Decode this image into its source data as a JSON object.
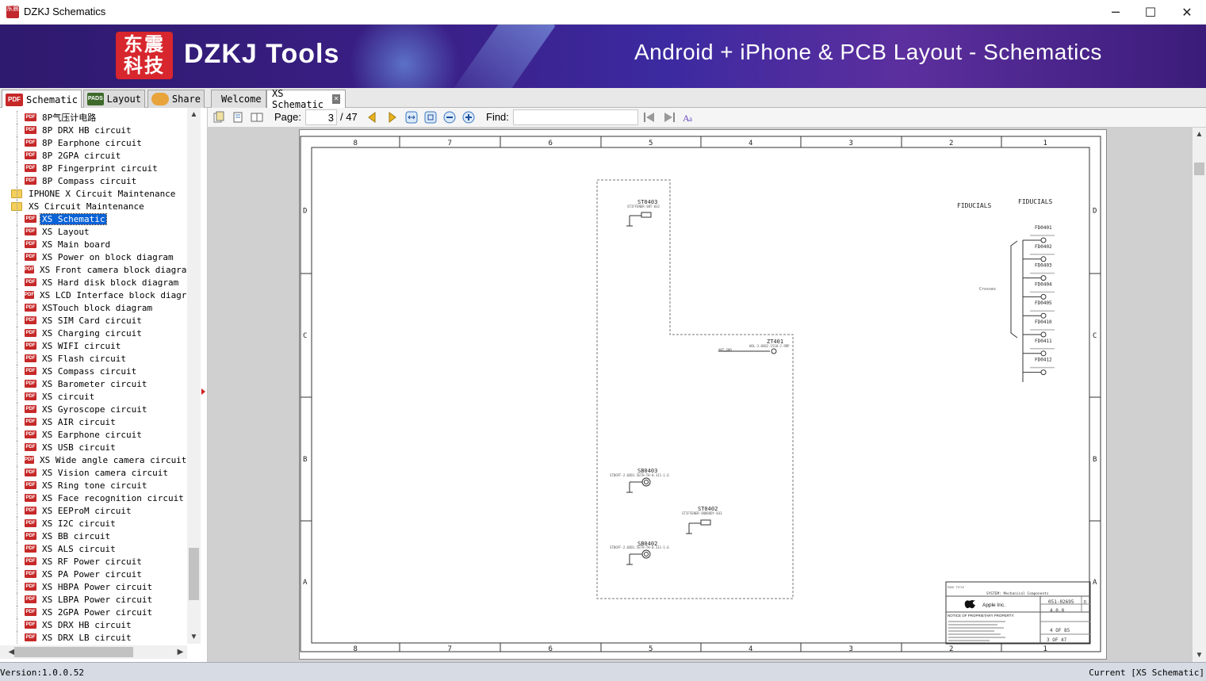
{
  "window": {
    "title": "DZKJ Schematics",
    "icon_label": "东震",
    "minimize": "─",
    "maximize": "☐",
    "close": "✕"
  },
  "banner": {
    "logo_line1": "东震",
    "logo_line2": "科技",
    "brand": "DZKJ Tools",
    "tagline": "Android + iPhone & PCB Layout - Schematics"
  },
  "left_tabs": [
    {
      "icon": "PDF",
      "label": "Schematic"
    },
    {
      "icon": "PADS",
      "label": "Layout"
    },
    {
      "icon": "",
      "label": "Share"
    }
  ],
  "doc_tabs": [
    {
      "label": "Welcome"
    },
    {
      "label": "XS Schematic"
    }
  ],
  "tree": {
    "items": [
      {
        "type": "pdf",
        "label": "8P气压计电路",
        "level": 2
      },
      {
        "type": "pdf",
        "label": "8P DRX HB circuit",
        "level": 2
      },
      {
        "type": "pdf",
        "label": "8P Earphone circuit",
        "level": 2
      },
      {
        "type": "pdf",
        "label": "8P 2GPA circuit",
        "level": 2
      },
      {
        "type": "pdf",
        "label": "8P Fingerprint circuit",
        "level": 2
      },
      {
        "type": "pdf",
        "label": "8P Compass circuit",
        "level": 2
      },
      {
        "type": "folder",
        "label": "IPHONE X Circuit Maintenance",
        "level": 1
      },
      {
        "type": "folder",
        "label": "XS Circuit Maintenance",
        "level": 1
      },
      {
        "type": "pdf",
        "label": "XS Schematic",
        "level": 2,
        "selected": true
      },
      {
        "type": "pdf",
        "label": "XS Layout",
        "level": 2
      },
      {
        "type": "pdf",
        "label": "XS Main board",
        "level": 2
      },
      {
        "type": "pdf",
        "label": "XS Power on block diagram",
        "level": 2
      },
      {
        "type": "pdf",
        "label": "XS Front camera block diagram",
        "level": 2
      },
      {
        "type": "pdf",
        "label": "XS Hard disk block diagram",
        "level": 2
      },
      {
        "type": "pdf",
        "label": "XS LCD Interface block diagram",
        "level": 2
      },
      {
        "type": "pdf",
        "label": "XSTouch block diagram",
        "level": 2
      },
      {
        "type": "pdf",
        "label": "XS SIM Card circuit",
        "level": 2
      },
      {
        "type": "pdf",
        "label": "XS Charging circuit",
        "level": 2
      },
      {
        "type": "pdf",
        "label": "XS WIFI circuit",
        "level": 2
      },
      {
        "type": "pdf",
        "label": "XS Flash circuit",
        "level": 2
      },
      {
        "type": "pdf",
        "label": "XS Compass circuit",
        "level": 2
      },
      {
        "type": "pdf",
        "label": "XS Barometer circuit",
        "level": 2
      },
      {
        "type": "pdf",
        "label": "XS circuit",
        "level": 2
      },
      {
        "type": "pdf",
        "label": "XS Gyroscope circuit",
        "level": 2
      },
      {
        "type": "pdf",
        "label": "XS AIR circuit",
        "level": 2
      },
      {
        "type": "pdf",
        "label": "XS Earphone circuit",
        "level": 2
      },
      {
        "type": "pdf",
        "label": "XS USB circuit",
        "level": 2
      },
      {
        "type": "pdf",
        "label": "XS Wide angle camera circuit",
        "level": 2
      },
      {
        "type": "pdf",
        "label": "XS Vision camera circuit",
        "level": 2
      },
      {
        "type": "pdf",
        "label": "XS Ring tone circuit",
        "level": 2
      },
      {
        "type": "pdf",
        "label": "XS Face recognition circuit",
        "level": 2
      },
      {
        "type": "pdf",
        "label": "XS EEProM circuit",
        "level": 2
      },
      {
        "type": "pdf",
        "label": "XS I2C circuit",
        "level": 2
      },
      {
        "type": "pdf",
        "label": "XS BB circuit",
        "level": 2
      },
      {
        "type": "pdf",
        "label": "XS ALS circuit",
        "level": 2
      },
      {
        "type": "pdf",
        "label": "XS RF Power circuit",
        "level": 2
      },
      {
        "type": "pdf",
        "label": "XS PA Power circuit",
        "level": 2
      },
      {
        "type": "pdf",
        "label": "XS HBPA Power circuit",
        "level": 2
      },
      {
        "type": "pdf",
        "label": "XS LBPA Power circuit",
        "level": 2
      },
      {
        "type": "pdf",
        "label": "XS 2GPA Power circuit",
        "level": 2
      },
      {
        "type": "pdf",
        "label": "XS DRX HB circuit",
        "level": 2
      },
      {
        "type": "pdf",
        "label": "XS DRX LB circuit",
        "level": 2
      }
    ]
  },
  "toolbar": {
    "page_label": "Page:",
    "page_current": "3",
    "page_total": "/ 47",
    "find_label": "Find:",
    "find_value": ""
  },
  "schematic": {
    "col_labels": [
      "8",
      "7",
      "6",
      "5",
      "4",
      "3",
      "2",
      "1"
    ],
    "row_labels": [
      "D",
      "C",
      "B",
      "A"
    ],
    "fiducials_title_left": "FIDUCIALS",
    "fiducials_title_right": "FIDUCIALS",
    "fiducial_refs": [
      "FD0401",
      "FD0402",
      "FD0403",
      "FD0404",
      "FD0405",
      "FD0410",
      "FD0411",
      "FD0412"
    ],
    "crosses_label": "Crosses",
    "comp_st0403": "ST0403",
    "comp_st0403_desc": "STIFFENER-SNT-032",
    "comp_zt401": "ZT401",
    "comp_zt401_desc": "HOL-3.0X02.1510-2.9RP",
    "comp_zt401_net": "ANT_GND",
    "comp_sb0403": "SB0403",
    "comp_sb0403_desc": "STDOFF-2.6OD1.5ETH-TH-0.311-1.6",
    "comp_st0402": "ST0402",
    "comp_st0402_desc": "STIFFENER-SNOBODY-033",
    "comp_sb0402": "SB0402",
    "comp_sb0402_desc": "STDOFF-2.6OD1.5ETH-TH-0.311-1.6",
    "tb_company": "Apple Inc.",
    "tb_title": "SYSTEM: Mechanical Components",
    "tb_dwg_no": "051-02695",
    "tb_rev": "4.0.0",
    "tb_size": "D",
    "tb_page": "4 OF 85",
    "tb_sheet": "3 OF 47",
    "tb_notice": "NOTICE OF PROPRIETARY PROPERTY:",
    "tb_page_title": "PAGE TITLE"
  },
  "status": {
    "version": "Version:1.0.0.52",
    "current": "Current [XS Schematic]"
  },
  "colors": {
    "banner_bg": "#3a1f86",
    "selection": "#0a62d6",
    "pdf_red": "#c62828"
  }
}
